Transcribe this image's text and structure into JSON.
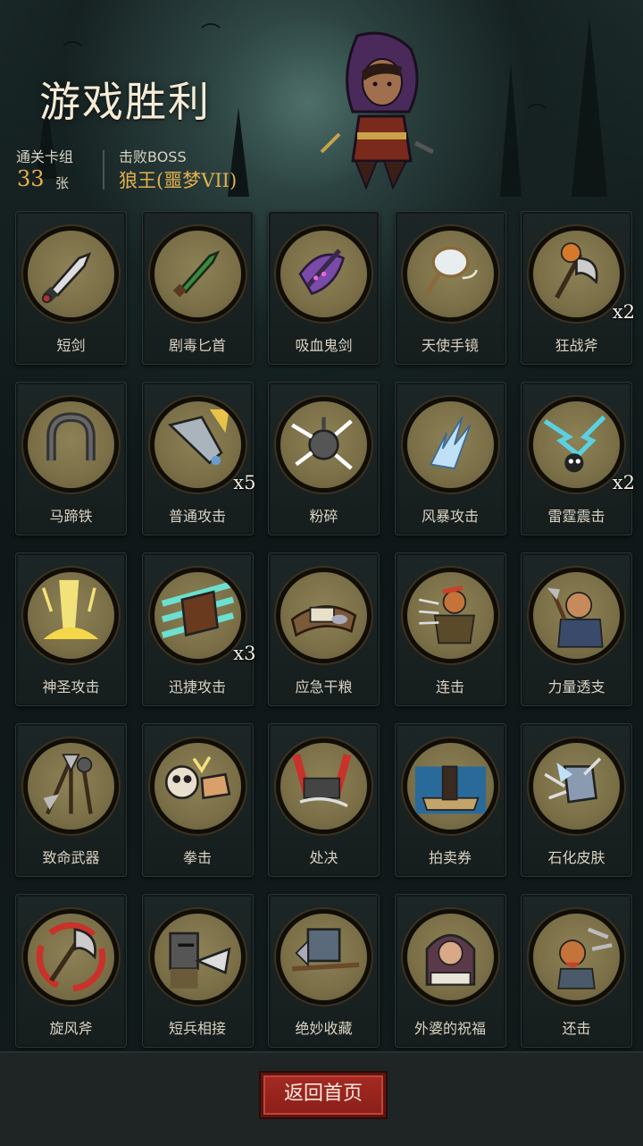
{
  "header": {
    "title": "游戏胜利",
    "deck_label": "通关卡组",
    "deck_count": "33",
    "deck_unit": "张",
    "boss_label": "击败BOSS",
    "boss_name": "狼王(噩梦VII)"
  },
  "cards": [
    {
      "name": "短剑",
      "icon": "short-sword-icon",
      "count": ""
    },
    {
      "name": "剧毒匕首",
      "icon": "poison-dagger-icon",
      "count": ""
    },
    {
      "name": "吸血鬼剑",
      "icon": "vampire-sword-icon",
      "count": ""
    },
    {
      "name": "天使手镜",
      "icon": "angel-mirror-icon",
      "count": ""
    },
    {
      "name": "狂战斧",
      "icon": "berserker-axe-icon",
      "count": "x2"
    },
    {
      "name": "马蹄铁",
      "icon": "horseshoe-icon",
      "count": ""
    },
    {
      "name": "普通攻击",
      "icon": "normal-attack-icon",
      "count": "x5"
    },
    {
      "name": "粉碎",
      "icon": "smash-icon",
      "count": ""
    },
    {
      "name": "风暴攻击",
      "icon": "storm-attack-icon",
      "count": ""
    },
    {
      "name": "雷霆震击",
      "icon": "thunder-strike-icon",
      "count": "x2"
    },
    {
      "name": "神圣攻击",
      "icon": "holy-attack-icon",
      "count": ""
    },
    {
      "name": "迅捷攻击",
      "icon": "swift-attack-icon",
      "count": "x3"
    },
    {
      "name": "应急干粮",
      "icon": "emergency-ration-icon",
      "count": ""
    },
    {
      "name": "连击",
      "icon": "combo-archer-icon",
      "count": ""
    },
    {
      "name": "力量透支",
      "icon": "power-overdraw-icon",
      "count": ""
    },
    {
      "name": "致命武器",
      "icon": "deadly-weapons-icon",
      "count": ""
    },
    {
      "name": "拳击",
      "icon": "punch-icon",
      "count": ""
    },
    {
      "name": "处决",
      "icon": "execute-icon",
      "count": ""
    },
    {
      "name": "拍卖券",
      "icon": "auction-ticket-icon",
      "count": ""
    },
    {
      "name": "石化皮肤",
      "icon": "petrified-skin-icon",
      "count": ""
    },
    {
      "name": "旋风斧",
      "icon": "whirlwind-axe-icon",
      "count": ""
    },
    {
      "name": "短兵相接",
      "icon": "close-combat-icon",
      "count": ""
    },
    {
      "name": "绝妙收藏",
      "icon": "fine-collection-icon",
      "count": ""
    },
    {
      "name": "外婆的祝福",
      "icon": "grandma-blessing-icon",
      "count": ""
    },
    {
      "name": "还击",
      "icon": "counterattack-icon",
      "count": ""
    }
  ],
  "footer": {
    "home_button": "返回首页"
  },
  "colors": {
    "accent_gold": "#e5b04e",
    "medal_fill": "#7a6f47",
    "button_red": "#a52a22"
  }
}
